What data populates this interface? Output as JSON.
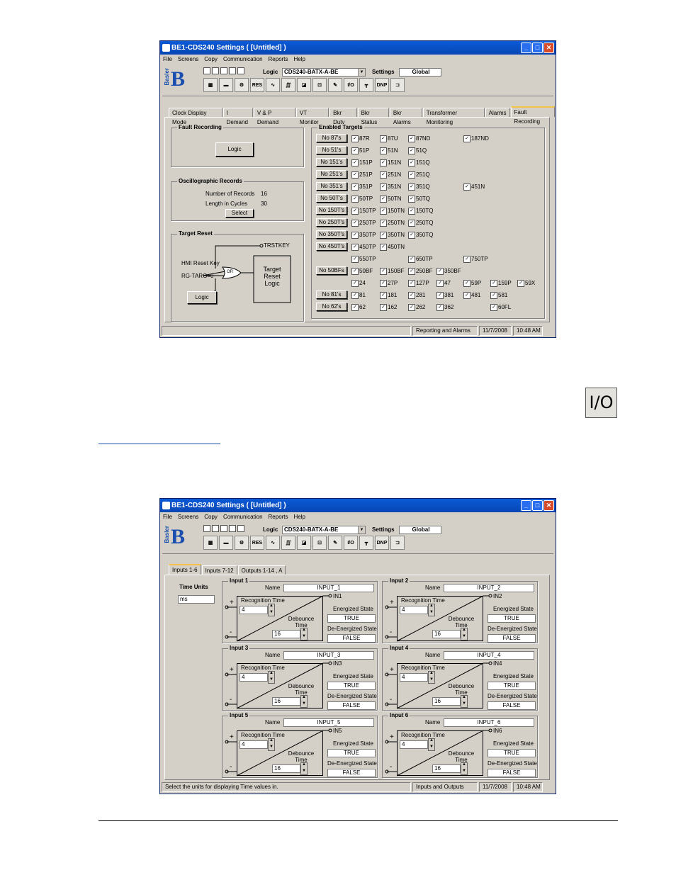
{
  "window1": {
    "title": "BE1-CDS240 Settings    ( [Untitled] )",
    "menu": [
      "File",
      "Screens",
      "Copy",
      "Communication",
      "Reports",
      "Help"
    ],
    "logic_label": "Logic",
    "logic_value": "CDS240-BATX-A-BE",
    "settings_label": "Settings",
    "settings_value": "Global",
    "basler_text": "Basler",
    "tabs": [
      "Clock Display Mode",
      "I Demand",
      "V & P Demand",
      "VT Monitor",
      "Bkr Duty",
      "Bkr Status",
      "Bkr Alarms",
      "Transformer Monitoring",
      "Alarms",
      "Fault Recording"
    ],
    "fault_recording": {
      "title": "Fault Recording",
      "logic_btn": "Logic"
    },
    "oscillographic": {
      "title": "Oscillographic Records",
      "num_label": "Number of Records",
      "num_value": "16",
      "len_label": "Length in Cycles",
      "len_value": "30",
      "select_btn": "Select"
    },
    "target_reset": {
      "title": "Target Reset",
      "trstkey": "TRSTKEY",
      "hmi": "HMI Reset Key",
      "rg": "RG-TARG=0",
      "or": "OR",
      "box": "Target Reset Logic",
      "logic_btn": "Logic"
    },
    "enabled_targets": {
      "title": "Enabled Targets",
      "buttons": [
        "No 87's",
        "No 51's",
        "No 151's",
        "No 251's",
        "No 351's",
        "No 50T's",
        "No 150T's",
        "No 250T's",
        "No 350T's",
        "No 450T's",
        "No 50BFs",
        "No 81's",
        "No 62's"
      ],
      "rows": [
        [
          "87R",
          "87U",
          "87ND",
          "",
          "187ND"
        ],
        [
          "51P",
          "51N",
          "51Q"
        ],
        [
          "151P",
          "151N",
          "151Q"
        ],
        [
          "251P",
          "251N",
          "251Q"
        ],
        [
          "351P",
          "351N",
          "351Q",
          "",
          "451N"
        ],
        [
          "50TP",
          "50TN",
          "50TQ"
        ],
        [
          "150TP",
          "150TN",
          "150TQ"
        ],
        [
          "250TP",
          "250TN",
          "250TQ"
        ],
        [
          "350TP",
          "350TN",
          "350TQ"
        ],
        [
          "450TP",
          "450TN"
        ],
        [
          "550TP",
          "",
          "650TP",
          "",
          "750TP"
        ],
        [
          "50BF",
          "150BF",
          "250BF",
          "350BF"
        ],
        [
          "24",
          "27P",
          "127P",
          "47",
          "59P",
          "159P",
          "59X"
        ],
        [
          "81",
          "181",
          "281",
          "381",
          "481",
          "581"
        ],
        [
          "62",
          "162",
          "262",
          "362",
          "",
          "60FL"
        ]
      ]
    },
    "status": {
      "message": "",
      "section": "Reporting and Alarms",
      "date": "11/7/2008",
      "time": "10:48 AM"
    }
  },
  "io_icon": "I/O",
  "window2": {
    "title": "BE1-CDS240 Settings    ( [Untitled] )",
    "menu": [
      "File",
      "Screens",
      "Copy",
      "Communication",
      "Reports",
      "Help"
    ],
    "logic_label": "Logic",
    "logic_value": "CDS240-BATX-A-BE",
    "settings_label": "Settings",
    "settings_value": "Global",
    "basler_text": "Basler",
    "tabs": [
      "Inputs 1-6",
      "Inputs 7-12",
      "Outputs 1-14 , A"
    ],
    "time_units_label": "Time Units",
    "time_units_value": "ms",
    "inputs": [
      {
        "title": "Input 1",
        "name": "INPUT_1",
        "in": "IN1"
      },
      {
        "title": "Input 2",
        "name": "INPUT_2",
        "in": "IN2"
      },
      {
        "title": "Input 3",
        "name": "INPUT_3",
        "in": "IN3"
      },
      {
        "title": "Input 4",
        "name": "INPUT_4",
        "in": "IN4"
      },
      {
        "title": "Input 5",
        "name": "INPUT_5",
        "in": "IN5"
      },
      {
        "title": "Input 6",
        "name": "INPUT_6",
        "in": "IN6"
      }
    ],
    "input_labels": {
      "name": "Name",
      "recog": "Recognition Time",
      "recog_value": "4",
      "debounce": "Debounce Time",
      "debounce_value": "16",
      "energized": "Energized State",
      "energized_value": "TRUE",
      "deenergized": "De-Energized State",
      "deenergized_value": "FALSE",
      "plus": "+",
      "minus": "-"
    },
    "status": {
      "message": "Select the units for displaying Time values in.",
      "section": "Inputs and Outputs",
      "date": "11/7/2008",
      "time": "10:48 AM"
    }
  }
}
